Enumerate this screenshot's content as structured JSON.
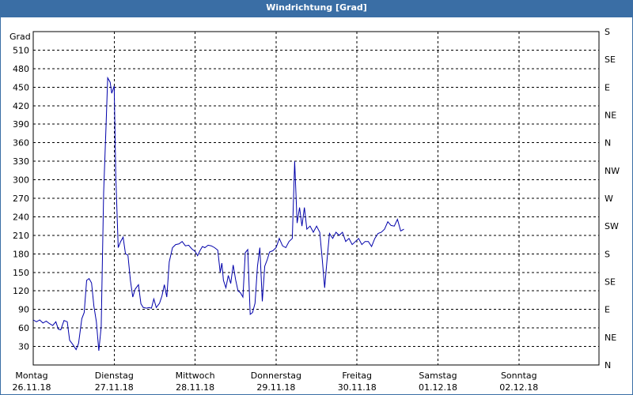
{
  "window": {
    "title": "Windrichtung [Grad]"
  },
  "colors": {
    "titlebar": "#3a6ea5",
    "line": "#0000aa",
    "grid": "#000000",
    "background": "#ffffff"
  },
  "chart_data": {
    "type": "line",
    "title": "Windrichtung [Grad]",
    "ylabel": "Grad",
    "ylim": [
      0,
      540
    ],
    "xlim": [
      0,
      7
    ],
    "y_ticks": [
      30,
      60,
      90,
      120,
      150,
      180,
      210,
      240,
      270,
      300,
      330,
      360,
      390,
      420,
      450,
      480,
      510
    ],
    "right_axis_labels": [
      "S",
      "SE",
      "E",
      "NE",
      "N",
      "NW",
      "W",
      "SW",
      "S",
      "SE",
      "E",
      "NE",
      "N"
    ],
    "right_axis_values": [
      540,
      495,
      450,
      405,
      360,
      315,
      270,
      225,
      180,
      135,
      90,
      45,
      0
    ],
    "x_ticks": [
      {
        "x": 0,
        "day": "Montag",
        "date": "26.11.18"
      },
      {
        "x": 1,
        "day": "Dienstag",
        "date": "27.11.18"
      },
      {
        "x": 2,
        "day": "Mittwoch",
        "date": "28.11.18"
      },
      {
        "x": 3,
        "day": "Donnerstag",
        "date": "29.11.18"
      },
      {
        "x": 4,
        "day": "Freitag",
        "date": "30.11.18"
      },
      {
        "x": 5,
        "day": "Samstag",
        "date": "01.12.18"
      },
      {
        "x": 6,
        "day": "Sonntag",
        "date": "02.12.18"
      }
    ],
    "grid": true,
    "series": [
      {
        "points": [
          [
            0.0,
            73
          ],
          [
            0.04,
            70
          ],
          [
            0.08,
            73
          ],
          [
            0.12,
            68
          ],
          [
            0.16,
            71
          ],
          [
            0.2,
            67
          ],
          [
            0.24,
            64
          ],
          [
            0.28,
            70
          ],
          [
            0.31,
            58
          ],
          [
            0.34,
            57
          ],
          [
            0.38,
            72
          ],
          [
            0.42,
            70
          ],
          [
            0.45,
            40
          ],
          [
            0.49,
            33
          ],
          [
            0.53,
            25
          ],
          [
            0.56,
            35
          ],
          [
            0.6,
            75
          ],
          [
            0.63,
            85
          ],
          [
            0.66,
            137
          ],
          [
            0.69,
            140
          ],
          [
            0.72,
            133
          ],
          [
            0.75,
            95
          ],
          [
            0.78,
            70
          ],
          [
            0.81,
            23
          ],
          [
            0.84,
            62
          ],
          [
            0.87,
            280
          ],
          [
            0.9,
            390
          ],
          [
            0.92,
            465
          ],
          [
            0.95,
            458
          ],
          [
            0.97,
            440
          ],
          [
            1.0,
            452
          ],
          [
            1.02,
            308
          ],
          [
            1.05,
            190
          ],
          [
            1.08,
            200
          ],
          [
            1.11,
            207
          ],
          [
            1.14,
            180
          ],
          [
            1.17,
            178
          ],
          [
            1.2,
            137
          ],
          [
            1.23,
            110
          ],
          [
            1.26,
            123
          ],
          [
            1.3,
            130
          ],
          [
            1.33,
            99
          ],
          [
            1.36,
            93
          ],
          [
            1.4,
            92
          ],
          [
            1.43,
            93
          ],
          [
            1.46,
            92
          ],
          [
            1.49,
            107
          ],
          [
            1.52,
            93
          ],
          [
            1.56,
            100
          ],
          [
            1.59,
            112
          ],
          [
            1.62,
            130
          ],
          [
            1.65,
            110
          ],
          [
            1.68,
            167
          ],
          [
            1.72,
            190
          ],
          [
            1.76,
            195
          ],
          [
            1.8,
            196
          ],
          [
            1.84,
            200
          ],
          [
            1.88,
            193
          ],
          [
            1.92,
            194
          ],
          [
            1.96,
            188
          ],
          [
            2.0,
            184
          ],
          [
            2.03,
            177
          ],
          [
            2.06,
            185
          ],
          [
            2.09,
            192
          ],
          [
            2.12,
            190
          ],
          [
            2.16,
            194
          ],
          [
            2.2,
            193
          ],
          [
            2.24,
            190
          ],
          [
            2.28,
            186
          ],
          [
            2.31,
            150
          ],
          [
            2.33,
            165
          ],
          [
            2.35,
            137
          ],
          [
            2.38,
            125
          ],
          [
            2.41,
            145
          ],
          [
            2.44,
            132
          ],
          [
            2.47,
            162
          ],
          [
            2.5,
            138
          ],
          [
            2.53,
            120
          ],
          [
            2.56,
            117
          ],
          [
            2.59,
            110
          ],
          [
            2.62,
            182
          ],
          [
            2.65,
            187
          ],
          [
            2.68,
            82
          ],
          [
            2.71,
            85
          ],
          [
            2.74,
            100
          ],
          [
            2.77,
            160
          ],
          [
            2.8,
            190
          ],
          [
            2.83,
            103
          ],
          [
            2.86,
            160
          ],
          [
            2.89,
            170
          ],
          [
            2.92,
            183
          ],
          [
            2.96,
            185
          ],
          [
            3.0,
            190
          ],
          [
            3.04,
            205
          ],
          [
            3.08,
            193
          ],
          [
            3.12,
            190
          ],
          [
            3.16,
            200
          ],
          [
            3.2,
            205
          ],
          [
            3.23,
            330
          ],
          [
            3.26,
            230
          ],
          [
            3.29,
            255
          ],
          [
            3.32,
            225
          ],
          [
            3.35,
            255
          ],
          [
            3.38,
            220
          ],
          [
            3.42,
            225
          ],
          [
            3.46,
            215
          ],
          [
            3.5,
            225
          ],
          [
            3.54,
            215
          ],
          [
            3.57,
            172
          ],
          [
            3.6,
            125
          ],
          [
            3.63,
            170
          ],
          [
            3.66,
            213
          ],
          [
            3.7,
            205
          ],
          [
            3.74,
            215
          ],
          [
            3.78,
            210
          ],
          [
            3.82,
            215
          ],
          [
            3.86,
            200
          ],
          [
            3.9,
            205
          ],
          [
            3.94,
            195
          ],
          [
            3.98,
            200
          ],
          [
            4.02,
            205
          ],
          [
            4.06,
            195
          ],
          [
            4.1,
            200
          ],
          [
            4.14,
            200
          ],
          [
            4.18,
            192
          ],
          [
            4.22,
            205
          ],
          [
            4.26,
            213
          ],
          [
            4.3,
            215
          ],
          [
            4.34,
            220
          ],
          [
            4.38,
            232
          ],
          [
            4.42,
            226
          ],
          [
            4.46,
            225
          ],
          [
            4.5,
            236
          ],
          [
            4.54,
            217
          ],
          [
            4.58,
            220
          ]
        ]
      }
    ]
  }
}
